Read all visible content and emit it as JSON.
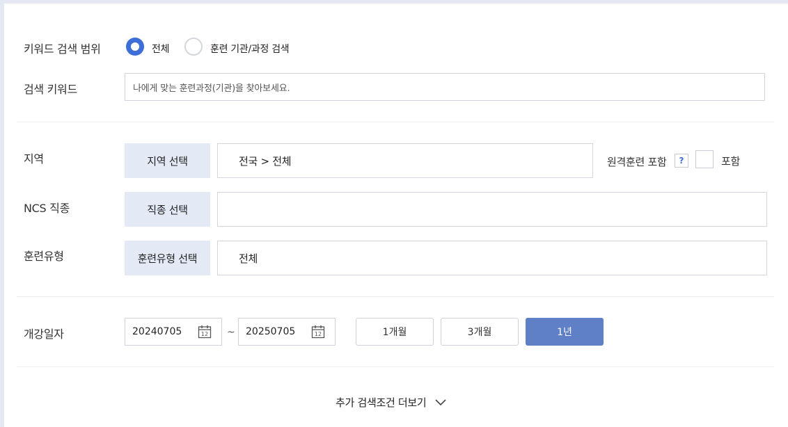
{
  "keyword_scope": {
    "label": "키워드 검색 범위",
    "options": [
      {
        "label": "전체",
        "selected": true
      },
      {
        "label": "훈련 기관/과정 검색",
        "selected": false
      }
    ]
  },
  "search_keyword": {
    "label": "검색 키워드",
    "placeholder": "나에게 맞는 훈련과정(기관)을 찾아보세요."
  },
  "region": {
    "label": "지역",
    "button": "지역 선택",
    "value": "전국 > 전체",
    "remote_label": "원격훈련 포함",
    "help": "?",
    "include_label": "포함",
    "include_checked": false
  },
  "ncs": {
    "label": "NCS 직종",
    "button": "직종 선택",
    "value": ""
  },
  "training_type": {
    "label": "훈련유형",
    "button": "훈련유형 선택",
    "value": "전체"
  },
  "start_date": {
    "label": "개강일자",
    "from": "20240705",
    "to": "20250705",
    "separator": "~",
    "calendar_day": "12",
    "periods": [
      {
        "label": "1개월",
        "active": false
      },
      {
        "label": "3개월",
        "active": false
      },
      {
        "label": "1년",
        "active": true
      }
    ]
  },
  "more_conditions": {
    "label": "추가 검색조건 더보기"
  },
  "colors": {
    "accent": "#3e6fd8",
    "active_button": "#5f7fc6",
    "select_button_bg": "#e3eaf6",
    "page_bg": "#e4e8f2"
  }
}
